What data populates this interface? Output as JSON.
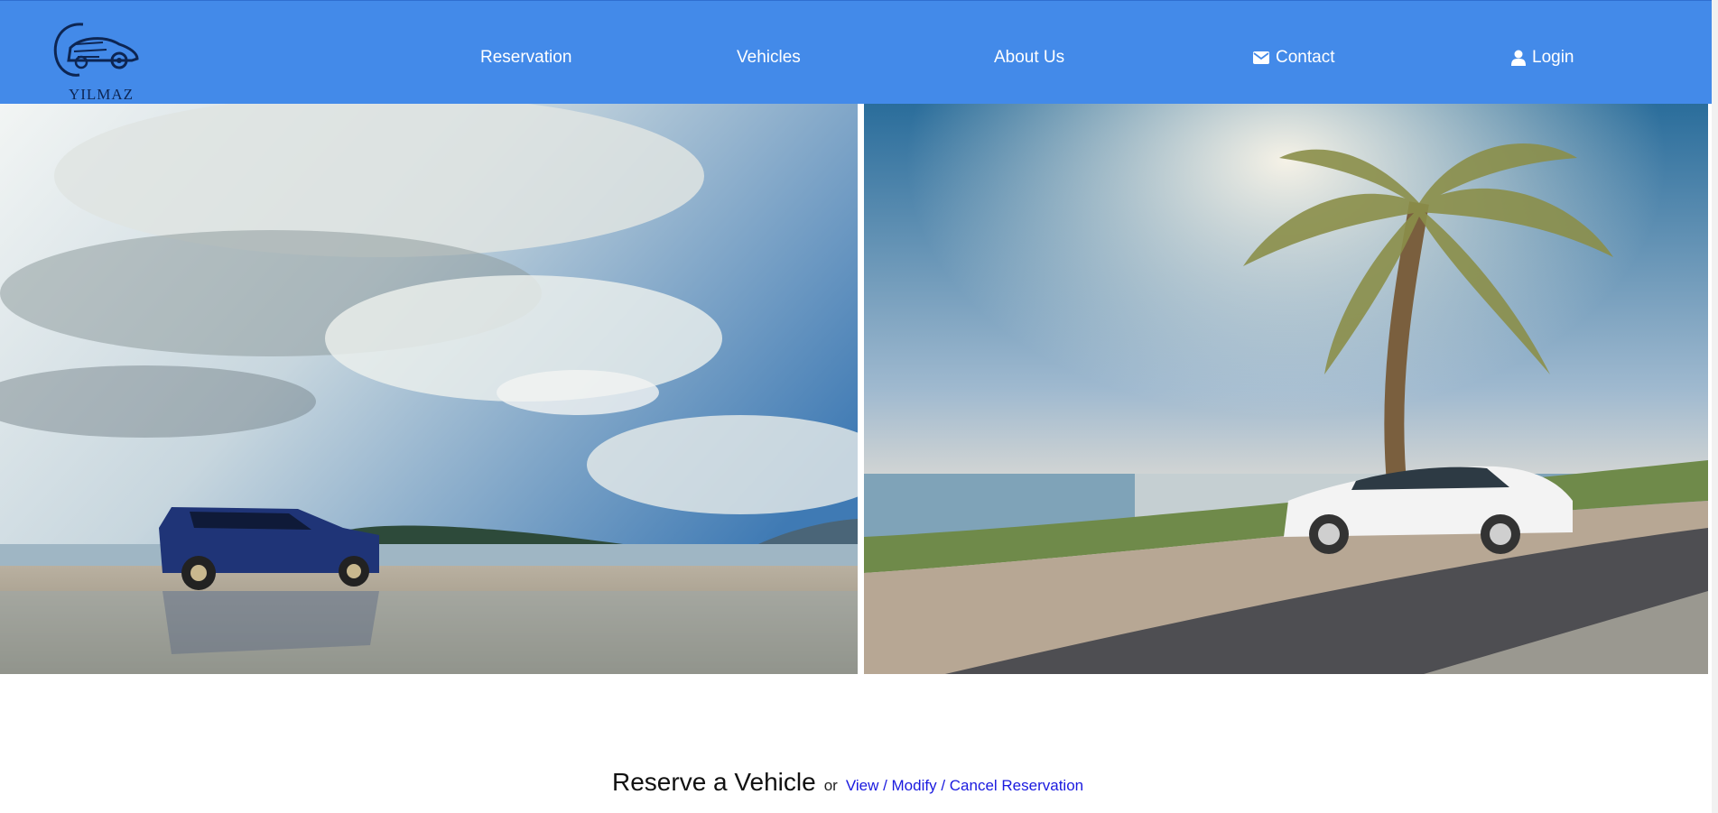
{
  "brand": {
    "name": "YILMAZ",
    "logo_icon": "car-logo-icon"
  },
  "nav": {
    "items": [
      {
        "label": "Reservation",
        "icon": ""
      },
      {
        "label": "Vehicles",
        "icon": ""
      },
      {
        "label": "About Us",
        "icon": ""
      },
      {
        "label": "Contact",
        "icon": "envelope-icon"
      },
      {
        "label": "Login",
        "icon": "user-icon"
      }
    ]
  },
  "hero": {
    "left_image": "beach-suv-photo",
    "right_image": "palm-coupe-photo"
  },
  "reserve": {
    "title": "Reserve a Vehicle",
    "or_text": "or",
    "link": "View / Modify / Cancel Reservation"
  },
  "colors": {
    "navbar": "#438ae9",
    "link": "#1a1adf"
  }
}
